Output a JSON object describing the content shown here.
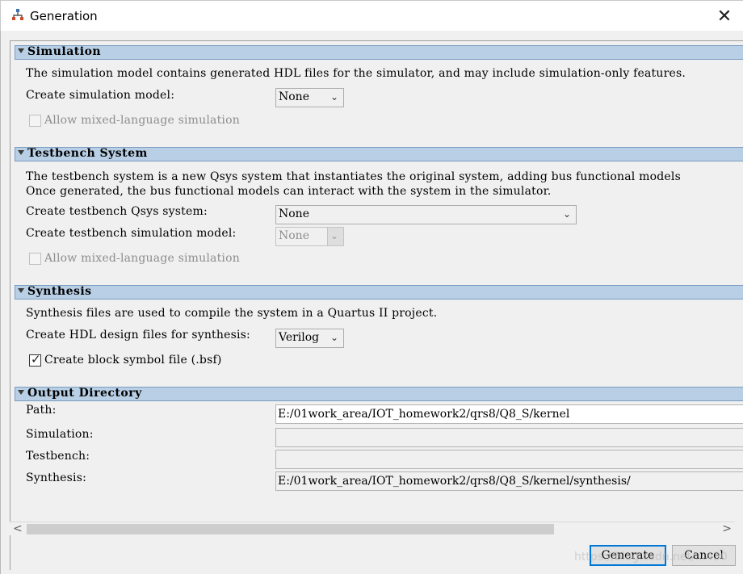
{
  "window": {
    "title": "Generation",
    "close_glyph": "✕",
    "icon": "qsys-app-icon"
  },
  "simulation": {
    "header": "Simulation",
    "description": "The simulation model contains generated HDL files for the simulator, and may include simulation-only features.",
    "create_model_label": "Create simulation model:",
    "create_model_value": "None",
    "mixed_language_label": "Allow mixed-language simulation",
    "mixed_language_checked": false,
    "mixed_language_enabled": false
  },
  "testbench": {
    "header": "Testbench System",
    "description_line1": "The testbench system is a new Qsys system that instantiates the original system, adding bus functional models",
    "description_line2": "Once generated, the bus functional models can interact with the system in the simulator.",
    "create_system_label": "Create testbench Qsys system:",
    "create_system_value": "None",
    "create_sim_model_label": "Create testbench simulation model:",
    "create_sim_model_value": "None",
    "mixed_language_label": "Allow mixed-language simulation",
    "mixed_language_checked": false,
    "mixed_language_enabled": false
  },
  "synthesis": {
    "header": "Synthesis",
    "description": "Synthesis files are used to compile the system in a Quartus II project.",
    "hdl_label": "Create HDL design files for synthesis:",
    "hdl_value": "Verilog",
    "bsf_label": "Create block symbol file (.bsf)",
    "bsf_checked": true
  },
  "output": {
    "header": "Output Directory",
    "path_label": "Path:",
    "path_value": "E:/01work_area/IOT_homework2/qrs8/Q8_S/kernel",
    "simulation_label": "Simulation:",
    "simulation_value": "",
    "testbench_label": "Testbench:",
    "testbench_value": "",
    "synthesis_label": "Synthesis:",
    "synthesis_value": "E:/01work_area/IOT_homework2/qrs8/Q8_S/kernel/synthesis/"
  },
  "scrollbar": {
    "left_arrow": "<",
    "right_arrow": ">"
  },
  "buttons": {
    "generate": "Generate",
    "cancel": "Cancel"
  },
  "watermark": "https://blog.csdn.net/...430",
  "colors": {
    "section_header_bg": "#b8cfe5",
    "primary_button_border": "#0078d7",
    "dialog_bg": "#f0f0f0"
  }
}
